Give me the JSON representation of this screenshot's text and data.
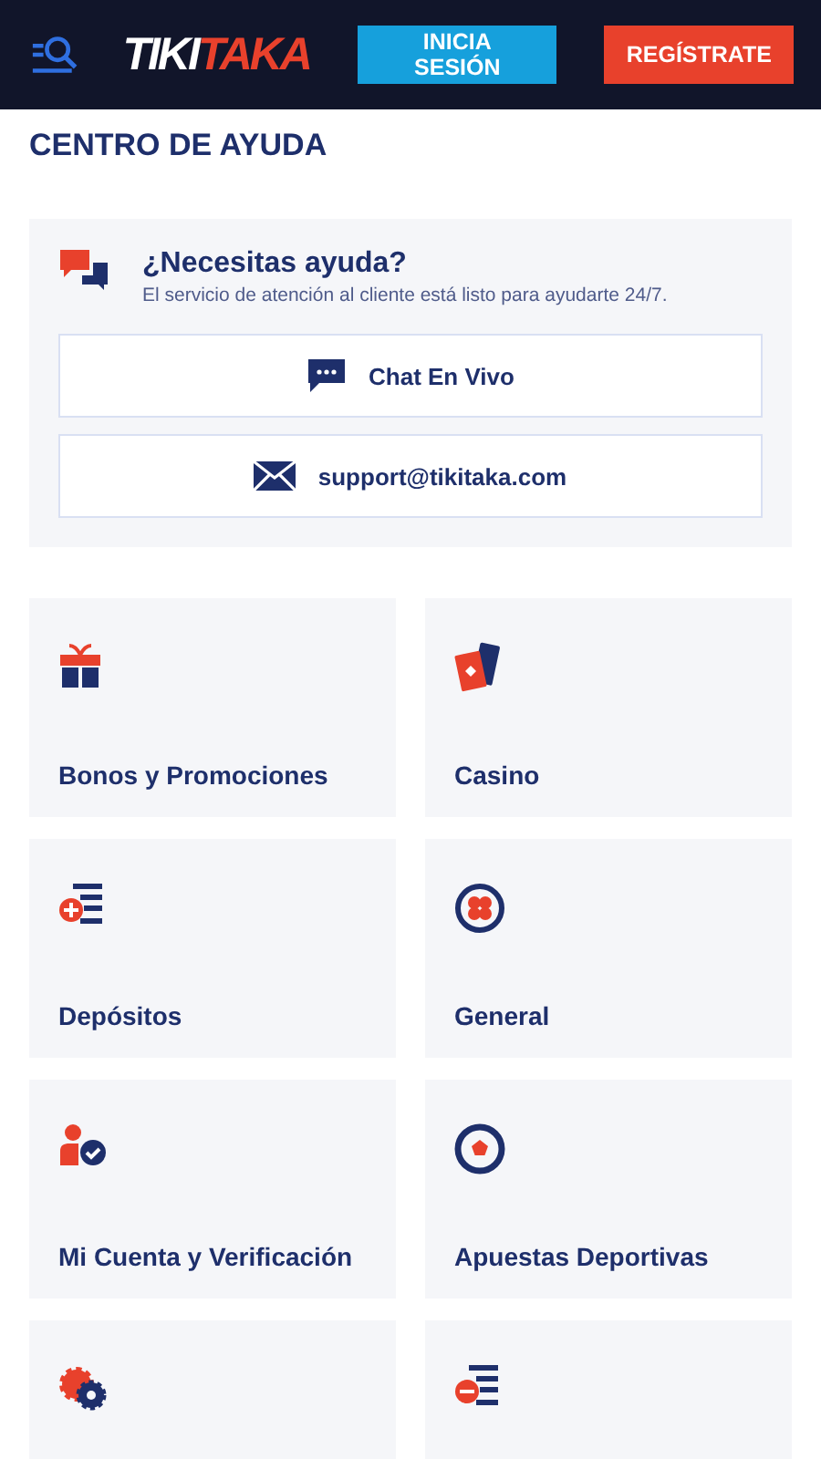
{
  "header": {
    "logo": [
      "TIKI",
      "TAKA"
    ],
    "buttons": [
      {
        "label": "INICIA SESIÓN",
        "kind": "login"
      },
      {
        "label": "REGÍSTRATE",
        "kind": "register"
      }
    ]
  },
  "page_title": "CENTRO DE AYUDA",
  "help": {
    "title": "¿Necesitas ayuda?",
    "subtitle": "El servicio de atención al cliente está listo para ayudarte 24/7.",
    "contacts": [
      {
        "label": "Chat En Vivo",
        "kind": "chat"
      },
      {
        "label": "support@tikitaka.com",
        "kind": "email"
      }
    ]
  },
  "categories": [
    {
      "label": "Bonos y Promociones",
      "kind": "gift"
    },
    {
      "label": "Casino",
      "kind": "cards"
    },
    {
      "label": "Depósitos",
      "kind": "deposit"
    },
    {
      "label": "General",
      "kind": "clover"
    },
    {
      "label": "Mi Cuenta y Verificación",
      "kind": "user"
    },
    {
      "label": "Apuestas Deportivas",
      "kind": "ball"
    },
    {
      "kind": "gears"
    },
    {
      "kind": "withdraw"
    }
  ]
}
